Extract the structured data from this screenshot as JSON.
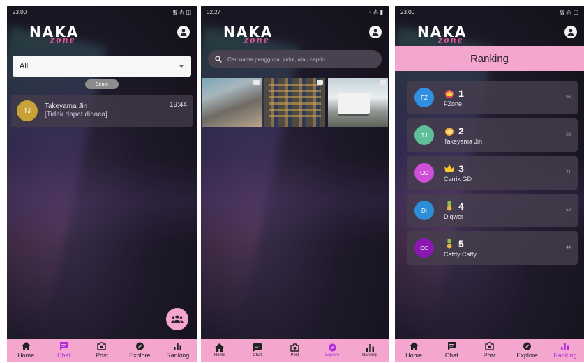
{
  "brand": {
    "logo": "NAKA",
    "logo_sub": "zone",
    "accent": "#f4a6cf",
    "active": "#b12be0"
  },
  "screen1": {
    "status": {
      "left": "23.00",
      "right": "᯾ ⁂ ◫"
    },
    "filter": {
      "selected": "All"
    },
    "day_chip": "Senin",
    "chat": {
      "initials": "TJ",
      "name": "Takeyama Jin",
      "message": "[Tidak dapat dibaca]",
      "time": "19:44"
    },
    "fab_icon": "group-icon",
    "active_tab": "Chat"
  },
  "screen2": {
    "status": {
      "left": "02.27",
      "right": "◔ ⁂ ▮"
    },
    "search": {
      "placeholder": "Cari nama pengguna, judul, atau captio..."
    },
    "active_tab": "Explore"
  },
  "screen3": {
    "status": {
      "left": "23.00",
      "right": "᯾ ⁂ ◫"
    },
    "header": "Ranking",
    "active_tab": "Ranking",
    "ranks": [
      {
        "initials": "FZ",
        "rank": "1",
        "name": "FZone",
        "score": "96",
        "avatar_color": "#2f8fe0",
        "badge": "crown-red-icon"
      },
      {
        "initials": "TJ",
        "rank": "2",
        "name": "Takeyama Jin",
        "score": "83",
        "avatar_color": "#5fbf9a",
        "badge": "crown-orange-icon"
      },
      {
        "initials": "CG",
        "rank": "3",
        "name": "Carrik GD",
        "score": "71",
        "avatar_color": "#d04fd8",
        "badge": "crown-yellow-icon"
      },
      {
        "initials": "DI",
        "rank": "4",
        "name": "Diqwer",
        "score": "52",
        "avatar_color": "#2c8ed8",
        "badge": "medal-icon"
      },
      {
        "initials": "CC",
        "rank": "5",
        "name": "Cafdy Caffy",
        "score": "44",
        "avatar_color": "#8b18b2",
        "badge": "medal-icon"
      }
    ]
  },
  "nav": {
    "home": "Home",
    "chat": "Chat",
    "post": "Post",
    "explore": "Explore",
    "ranking": "Ranking"
  }
}
